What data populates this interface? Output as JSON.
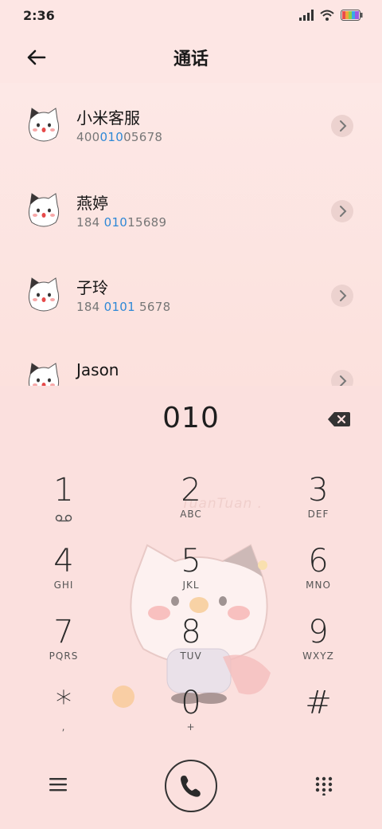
{
  "status": {
    "time": "2:36"
  },
  "header": {
    "title": "通话"
  },
  "contacts": [
    {
      "name": "小米客服",
      "number_pre": "400",
      "number_hl": "010",
      "number_post": "05678"
    },
    {
      "name": "燕婷",
      "number_pre": "184 ",
      "number_hl": "010",
      "number_post": "15689"
    },
    {
      "name": "子玲",
      "number_pre": "184 ",
      "number_hl": "0101",
      "number_post": " 5678"
    },
    {
      "name": "Jason",
      "number_pre": "",
      "number_hl": "",
      "number_post": ""
    }
  ],
  "dialer": {
    "input": "010",
    "watermark": "TuanTuan .",
    "keys": [
      {
        "digit": "1",
        "sub": "voicemail-icon"
      },
      {
        "digit": "2",
        "sub": "ABC"
      },
      {
        "digit": "3",
        "sub": "DEF"
      },
      {
        "digit": "4",
        "sub": "GHI"
      },
      {
        "digit": "5",
        "sub": "JKL"
      },
      {
        "digit": "6",
        "sub": "MNO"
      },
      {
        "digit": "7",
        "sub": "PQRS"
      },
      {
        "digit": "8",
        "sub": "TUV"
      },
      {
        "digit": "9",
        "sub": "WXYZ"
      },
      {
        "digit": "*",
        "sub": ","
      },
      {
        "digit": "0",
        "sub": "+"
      },
      {
        "digit": "#",
        "sub": ""
      }
    ]
  },
  "colors": {
    "highlight": "#2e88d6",
    "background": "#fde6e4",
    "dialer_bg": "#fbe0de"
  }
}
